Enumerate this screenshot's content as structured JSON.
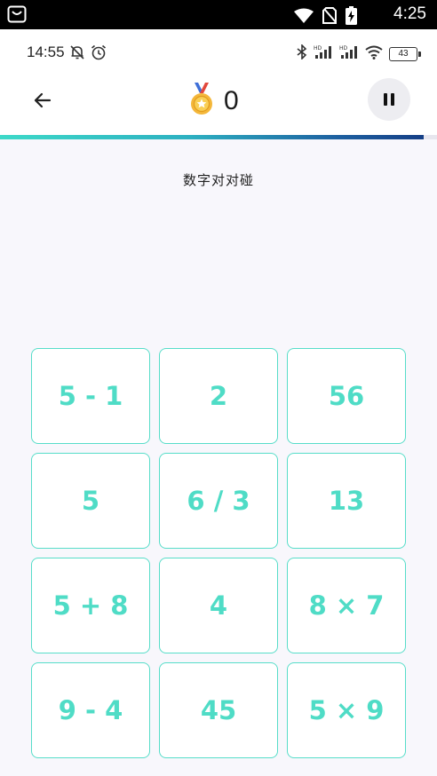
{
  "system_bar": {
    "time": "4:25",
    "battery_icon": "battery-charging-icon"
  },
  "phone_status": {
    "time": "14:55",
    "battery": "43"
  },
  "header": {
    "score": "0",
    "progress_percent": 97
  },
  "game": {
    "title": "数字对对碰",
    "tiles": [
      "5 - 1",
      "2",
      "56",
      "5",
      "6 / 3",
      "13",
      "5 + 8",
      "4",
      "8 × 7",
      "9 - 4",
      "45",
      "5 × 9"
    ]
  },
  "colors": {
    "accent": "#4fdcc6",
    "tile_border": "#57ddc9",
    "progress_end": "#153f86"
  }
}
